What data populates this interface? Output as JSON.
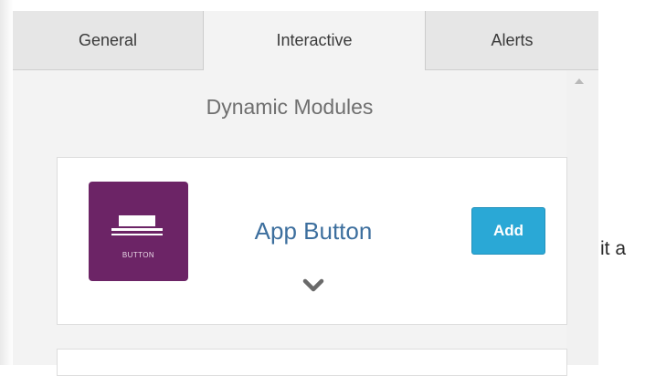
{
  "tabs": [
    {
      "label": "General",
      "active": false
    },
    {
      "label": "Interactive",
      "active": true
    },
    {
      "label": "Alerts",
      "active": false
    }
  ],
  "section": {
    "title": "Dynamic Modules"
  },
  "modules": [
    {
      "icon_name": "button-icon",
      "icon_caption": "BUTTON",
      "icon_color": "#6c2466",
      "name": "App Button",
      "add_label": "Add",
      "expand_icon": "chevron-down-icon"
    }
  ],
  "background_text": "it a",
  "colors": {
    "accent": "#2aa8d6",
    "link": "#3d6f9e"
  }
}
